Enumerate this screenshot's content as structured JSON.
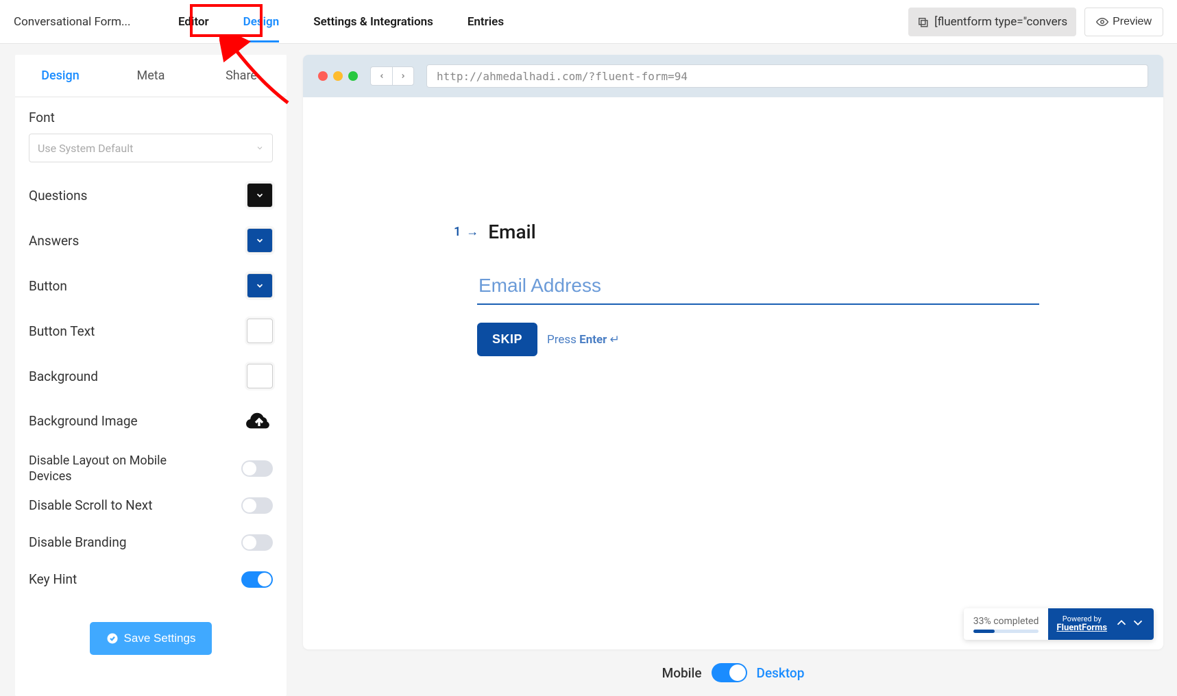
{
  "topbar": {
    "title": "Conversational Form...",
    "tabs": [
      "Editor",
      "Design",
      "Settings & Integrations",
      "Entries"
    ],
    "active_tab": 1,
    "shortcode": "[fluentform type=\"convers",
    "preview_label": "Preview"
  },
  "sidebar": {
    "tabs": [
      "Design",
      "Meta",
      "Share"
    ],
    "active_tab": 0,
    "font_label": "Font",
    "font_placeholder": "Use System Default",
    "settings": {
      "questions": {
        "label": "Questions",
        "color": "#111111"
      },
      "answers": {
        "label": "Answers",
        "color": "#0b4da2"
      },
      "button": {
        "label": "Button",
        "color": "#0b4da2"
      },
      "button_text": {
        "label": "Button Text",
        "color": "#ffffff"
      },
      "background": {
        "label": "Background",
        "color": "#ffffff"
      },
      "background_image": {
        "label": "Background Image"
      },
      "disable_layout_mobile": {
        "label": "Disable Layout on Mobile Devices",
        "on": false
      },
      "disable_scroll_next": {
        "label": "Disable Scroll to Next",
        "on": false
      },
      "disable_branding": {
        "label": "Disable Branding",
        "on": false
      },
      "key_hint": {
        "label": "Key Hint",
        "on": true
      }
    },
    "save_label": "Save Settings"
  },
  "preview": {
    "url": "http://ahmedalhadi.com/?fluent-form=94",
    "question_number": "1",
    "question_title": "Email",
    "input_placeholder": "Email Address",
    "skip_label": "SKIP",
    "hint_prefix": "Press ",
    "hint_key": "Enter",
    "hint_symbol": "↵",
    "progress_text": "33% completed",
    "progress_pct": 33,
    "powered_by_1": "Powered by",
    "powered_by_2": "FluentForms"
  },
  "device_toggle": {
    "mobile": "Mobile",
    "desktop": "Desktop"
  }
}
